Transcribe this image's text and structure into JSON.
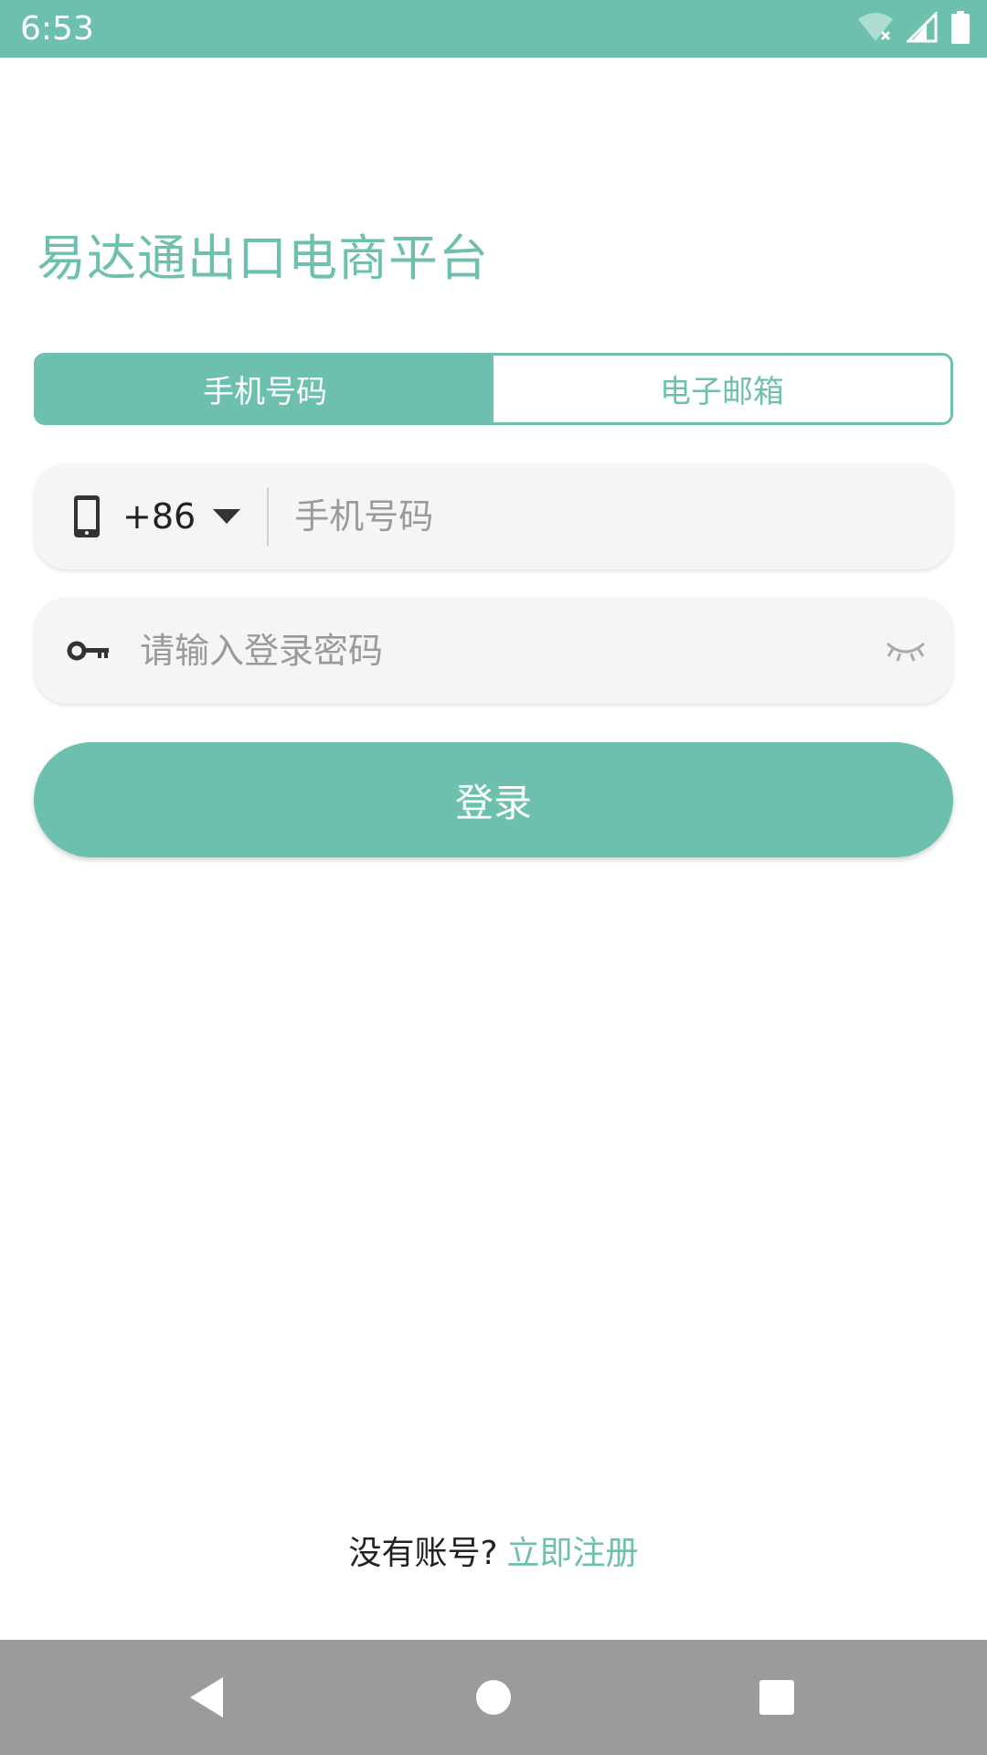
{
  "status_bar": {
    "time": "6:53",
    "icons": [
      "wifi-off-icon",
      "cell-signal-icon",
      "battery-icon"
    ]
  },
  "app": {
    "title": "易达通出口电商平台"
  },
  "tabs": [
    {
      "label": "手机号码",
      "active": true
    },
    {
      "label": "电子邮箱",
      "active": false
    }
  ],
  "phone_field": {
    "country_code": "+86",
    "value": "",
    "placeholder": "手机号码"
  },
  "password_field": {
    "value": "",
    "placeholder": "请输入登录密码"
  },
  "login": {
    "label": "登录"
  },
  "register": {
    "prompt": "没有账号?",
    "link": "立即注册"
  },
  "colors": {
    "accent": "#6dc0ad",
    "field_bg": "#f5f5f5",
    "nav_bg": "#9b9b9b"
  }
}
